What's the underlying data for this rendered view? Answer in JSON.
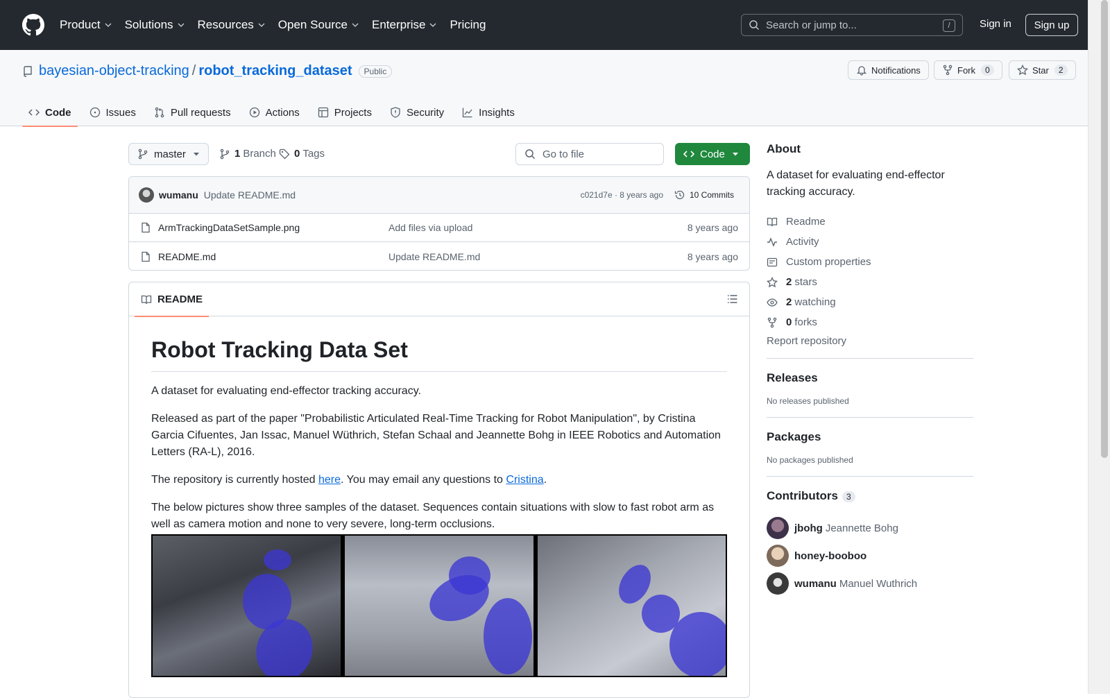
{
  "header": {
    "nav": [
      "Product",
      "Solutions",
      "Resources",
      "Open Source",
      "Enterprise",
      "Pricing"
    ],
    "search_placeholder": "Search or jump to...",
    "search_shortcut": "/",
    "signin": "Sign in",
    "signup": "Sign up"
  },
  "repo": {
    "owner": "bayesian-object-tracking",
    "separator": "/",
    "name": "robot_tracking_dataset",
    "visibility": "Public",
    "notifications": "Notifications",
    "fork_label": "Fork",
    "fork_count": "0",
    "star_label": "Star",
    "star_count": "2",
    "tabs": [
      "Code",
      "Issues",
      "Pull requests",
      "Actions",
      "Projects",
      "Security",
      "Insights"
    ]
  },
  "toolbar": {
    "branch": "master",
    "branch_count": "1",
    "branch_label": "Branch",
    "tag_count": "0",
    "tag_label": "Tags",
    "goto_placeholder": "Go to file",
    "code_button": "Code"
  },
  "commit": {
    "author": "wumanu",
    "message": "Update README.md",
    "sha_time": "c021d7e · 8 years ago",
    "commits": "10 Commits"
  },
  "files": [
    {
      "name": "ArmTrackingDataSetSample.png",
      "message": "Add files via upload",
      "date": "8 years ago"
    },
    {
      "name": "README.md",
      "message": "Update README.md",
      "date": "8 years ago"
    }
  ],
  "readme": {
    "tab": "README",
    "title": "Robot Tracking Data Set",
    "p1": "A dataset for evaluating end-effector tracking accuracy.",
    "p2": "Released as part of the paper \"Probabilistic Articulated Real-Time Tracking for Robot Manipulation\", by Cristina Garcia Cifuentes, Jan Issac, Manuel Wüthrich, Stefan Schaal and Jeannette Bohg in IEEE Robotics and Automation Letters (RA-L), 2016.",
    "p3_before": "The repository is currently hosted ",
    "p3_link1": "here",
    "p3_middle": ". You may email any questions to ",
    "p3_link2": "Cristina",
    "p3_after": ".",
    "p4": "The below pictures show three samples of the dataset. Sequences contain situations with slow to fast robot arm as well as camera motion and none to very severe, long-term occlusions."
  },
  "about": {
    "title": "About",
    "description": "A dataset for evaluating end-effector tracking accuracy.",
    "readme": "Readme",
    "activity": "Activity",
    "custom_properties": "Custom properties",
    "stars_count": "2",
    "stars_label": "stars",
    "watching_count": "2",
    "watching_label": "watching",
    "forks_count": "0",
    "forks_label": "forks",
    "report": "Report repository"
  },
  "releases": {
    "title": "Releases",
    "empty": "No releases published"
  },
  "packages": {
    "title": "Packages",
    "empty": "No packages published"
  },
  "contributors": {
    "title": "Contributors",
    "count": "3",
    "list": [
      {
        "login": "jbohg",
        "name": "Jeannette Bohg"
      },
      {
        "login": "honey-booboo",
        "name": ""
      },
      {
        "login": "wumanu",
        "name": "Manuel Wuthrich"
      }
    ]
  },
  "colors": {
    "accent": "#0969da",
    "primary_button": "#1f883d",
    "header_bg": "#24292f",
    "tab_underline": "#fd8c73"
  }
}
